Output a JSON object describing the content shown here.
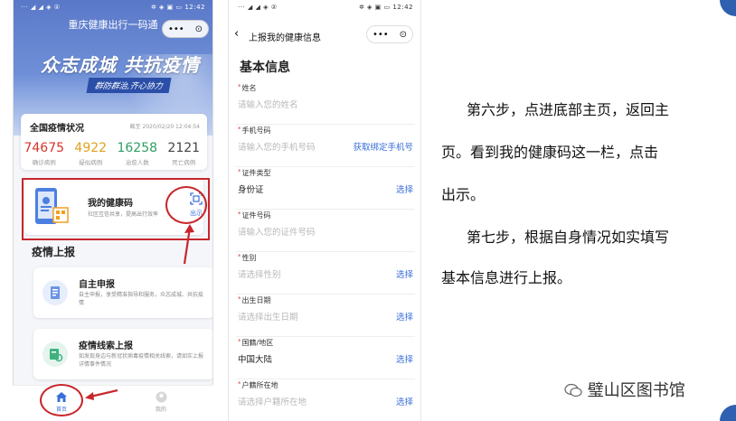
{
  "phone1": {
    "status_left": "··· ◢ ◢ ◈ ②",
    "status_right": "✲ ◈ ▣ ▭ 12:42",
    "app_title": "重庆健康出行一码通",
    "capsule_dots": "•••",
    "capsule_close": "⊙",
    "slogan": "众志成城 共抗疫情",
    "tagline": "群防群治,齐心协力",
    "stats": {
      "title": "全国疫情状况",
      "timestamp": "截至 2020/02/20 12:04:54",
      "items": [
        {
          "value": "74675",
          "label": "确诊病例",
          "color": "#d8342c"
        },
        {
          "value": "4922",
          "label": "疑似病例",
          "color": "#e0a21a"
        },
        {
          "value": "16258",
          "label": "治愈人数",
          "color": "#2e9e62"
        },
        {
          "value": "2121",
          "label": "死亡病例",
          "color": "#444444"
        }
      ]
    },
    "health_code": {
      "title": "我的健康码",
      "desc": "社区互信共享，提高出行效率",
      "show_label": "出示"
    },
    "section_title": "疫情上报",
    "reports": [
      {
        "title": "自主申报",
        "desc": "自主申报，享受精准指导和服务，众志成城、共抗疫情"
      },
      {
        "title": "疫情线索上报",
        "desc": "如发现身边与新冠状病毒疫情相关线索，请如实上报详情事件情况"
      }
    ],
    "tabs": {
      "home": "首页",
      "mine": "我的"
    }
  },
  "phone2": {
    "status_left": "··· ◢ ◢ ◈ ②",
    "status_right": "✲ ◈ ▣ ▭ 12:42",
    "back": "‹",
    "title": "上报我的健康信息",
    "capsule_dots": "•••",
    "capsule_close": "⊙",
    "heading": "基本信息",
    "fields": [
      {
        "label": "姓名",
        "value": "请输入您的姓名",
        "placeholder": true,
        "action": ""
      },
      {
        "label": "手机号码",
        "value": "请输入您的手机号码",
        "placeholder": true,
        "action": "获取绑定手机号"
      },
      {
        "label": "证件类型",
        "value": "身份证",
        "placeholder": false,
        "action": "选择"
      },
      {
        "label": "证件号码",
        "value": "请输入您的证件号码",
        "placeholder": true,
        "action": ""
      },
      {
        "label": "性别",
        "value": "请选择性别",
        "placeholder": true,
        "action": "选择"
      },
      {
        "label": "出生日期",
        "value": "请选择出生日期",
        "placeholder": true,
        "action": "选择"
      },
      {
        "label": "国籍/地区",
        "value": "中国大陆",
        "placeholder": false,
        "action": "选择"
      },
      {
        "label": "户籍所在地",
        "value": "请选择户籍所在地",
        "placeholder": true,
        "action": "选择"
      }
    ]
  },
  "instructions": {
    "lines": [
      "第六步，点进底部主页，返回主",
      "页。看到我的健康码这一栏，点击",
      "出示。",
      "第七步，根据自身情况如实填写",
      "基本信息进行上报。"
    ]
  },
  "watermark": "璧山区图书馆",
  "colors": {
    "accent": "#3a6fd8",
    "annotation_red": "#c8262b",
    "corner_blue": "#2e5fb0"
  }
}
